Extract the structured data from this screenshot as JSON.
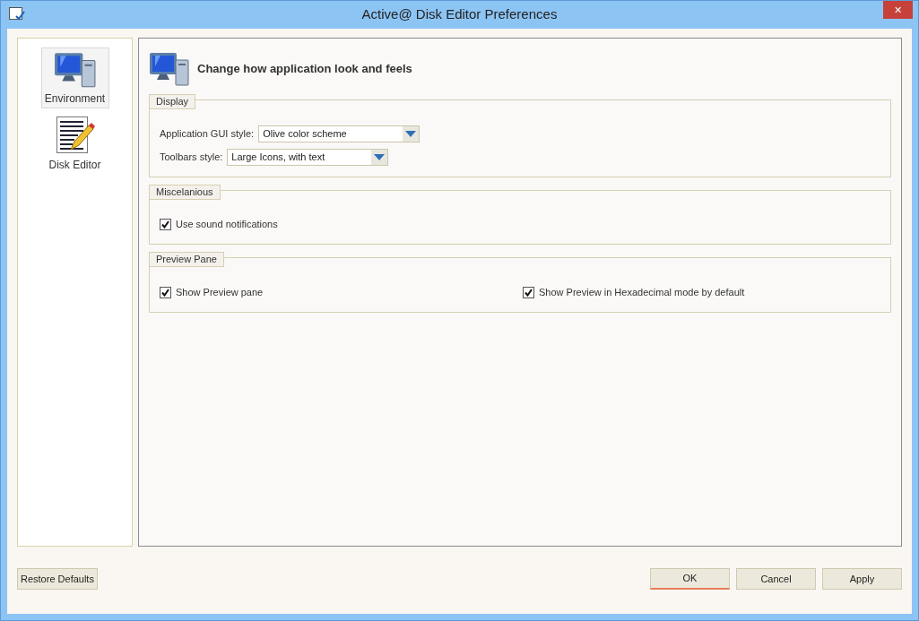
{
  "window": {
    "title": "Active@ Disk Editor Preferences",
    "close": "✕"
  },
  "sidebar": {
    "items": [
      {
        "label": "Environment",
        "kind": "computer",
        "selected": true
      },
      {
        "label": "Disk Editor",
        "kind": "document",
        "selected": false
      }
    ]
  },
  "header": {
    "title": "Change how application look and feels"
  },
  "groups": [
    {
      "title": "Display",
      "kind": "stack",
      "items": [
        {
          "kind": "select",
          "label": "Application GUI style:",
          "value": "Olive color scheme"
        },
        {
          "kind": "select",
          "label": "Toolbars style:",
          "value": "Large Icons, with text"
        }
      ]
    },
    {
      "title": "Miscelanious",
      "kind": "stack",
      "items": [
        {
          "kind": "checkbox",
          "label": "Use sound notifications",
          "checked": true
        }
      ]
    },
    {
      "title": "Preview Pane",
      "kind": "columns",
      "items": [
        {
          "kind": "checkbox",
          "label": "Show Preview pane",
          "checked": true
        },
        {
          "kind": "checkbox",
          "label": "Show Preview in Hexadecimal mode by default",
          "checked": true
        }
      ]
    }
  ],
  "restore_button": "Restore Defaults",
  "buttons": [
    {
      "label": "OK",
      "focused": true
    },
    {
      "label": "Cancel",
      "focused": false
    },
    {
      "label": "Apply",
      "focused": false
    }
  ]
}
